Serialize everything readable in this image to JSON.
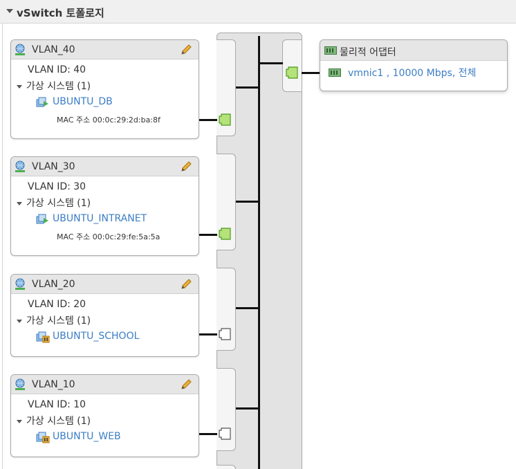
{
  "section": {
    "title": "vSwitch 토폴로지"
  },
  "port_groups": [
    {
      "name": "VLAN_40",
      "vlan_id": "VLAN ID: 40",
      "vm_group": "가상 시스템 (1)",
      "vm_name": "UBUNTU_DB",
      "vm_state": "powered-on",
      "mac": "MAC 주소 00:0c:29:2d:ba:8f",
      "port_state": "connected"
    },
    {
      "name": "VLAN_30",
      "vlan_id": "VLAN ID: 30",
      "vm_group": "가상 시스템 (1)",
      "vm_name": "UBUNTU_INTRANET",
      "vm_state": "powered-on",
      "mac": "MAC 주소 00:0c:29:fe:5a:5a",
      "port_state": "connected"
    },
    {
      "name": "VLAN_20",
      "vlan_id": "VLAN ID: 20",
      "vm_group": "가상 시스템 (1)",
      "vm_name": "UBUNTU_SCHOOL",
      "vm_state": "suspended",
      "mac": "",
      "port_state": "disconnected"
    },
    {
      "name": "VLAN_10",
      "vlan_id": "VLAN ID: 10",
      "vm_group": "가상 시스템 (1)",
      "vm_name": "UBUNTU_WEB",
      "vm_state": "suspended",
      "mac": "",
      "port_state": "disconnected"
    }
  ],
  "physical_adapters": {
    "title": "물리적 어댑터",
    "items": [
      {
        "label": "vmnic1 , 10000 Mbps, 전체"
      }
    ]
  },
  "colors": {
    "link": "#3b7dc4",
    "port_connected_fill": "#b5e27a",
    "port_connected_stroke": "#4e9a1e",
    "header_bg": "#e6e6e6"
  },
  "icons": {
    "network": "network-globe-icon",
    "edit": "pencil-icon",
    "vm_on": "vm-powered-on-icon",
    "vm_suspended": "vm-suspended-icon",
    "nic": "nic-icon"
  }
}
